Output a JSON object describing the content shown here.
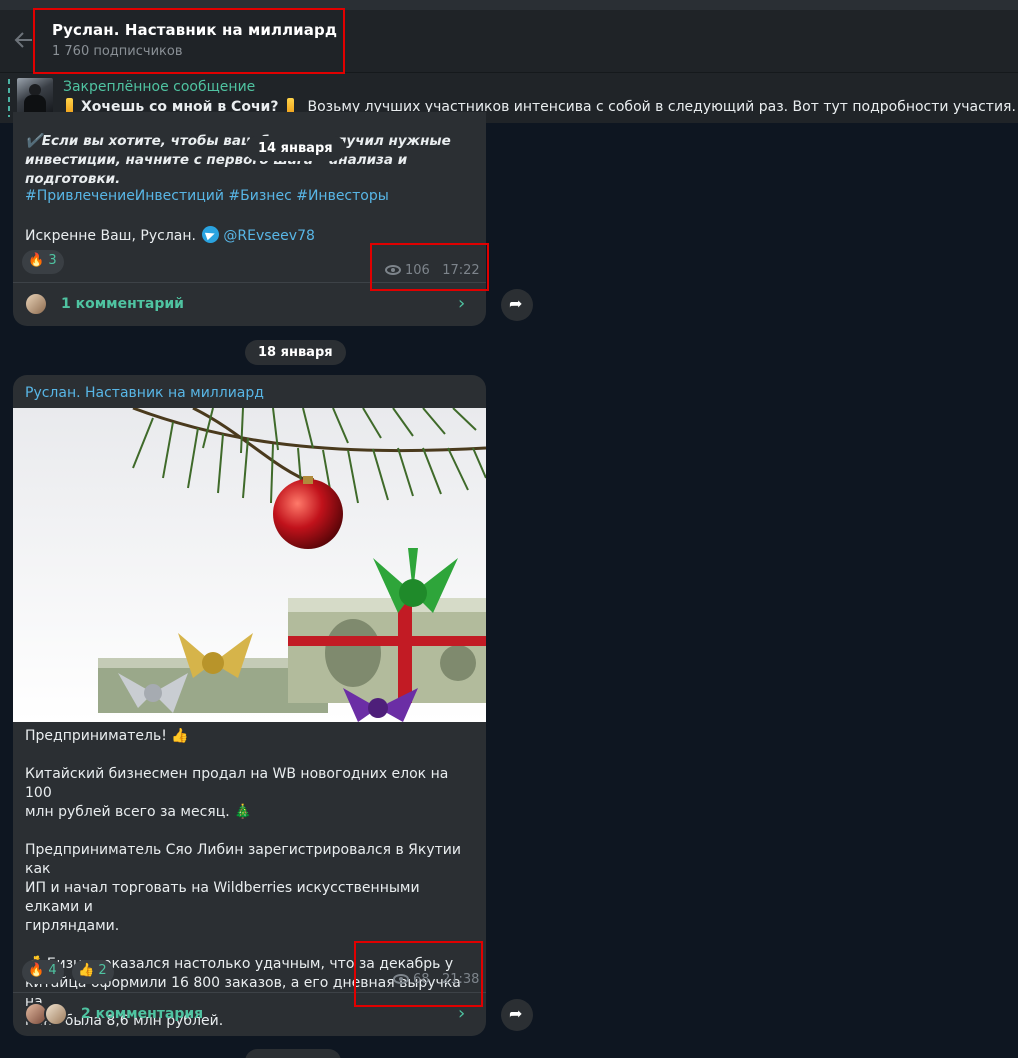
{
  "header": {
    "title": "Руслан. Наставник на миллиард",
    "subscribers": "1 760 подписчиков"
  },
  "pinned": {
    "title": "Закреплённое сообщение",
    "text_bold": "Хочешь со мной в Сочи?",
    "text_rest": "Возьму лучших участников интенсива с собой в следующий раз. Вот тут подробности участия."
  },
  "msg1": {
    "date_pill": "14 января",
    "text_line1": "✔️Если вы хотите, чтобы ваш бизнес получил нужные",
    "text_line2": "инвестиции, начните с первого шага – анализа и подготовки.",
    "hashtags": "#ПривлечениеИнвестиций #Бизнес #Инвесторы",
    "sign_text": "Искренне Ваш, Руслан.",
    "sign_user": "@REvseev78",
    "reaction": {
      "emoji": "🔥",
      "count": "3"
    },
    "views": "106",
    "time": "17:22",
    "comments": "1 комментарий"
  },
  "msg2": {
    "date_pill": "18 января",
    "sender": "Руслан. Наставник на миллиард",
    "body": "Предприниматель! 👍\n\nКитайский бизнесмен продал на WB новогодних елок на 100\nмлн рублей всего за месяц. 🎄\n\nПредприниматель Сяо Либин зарегистрировался в Якутии как\nИП и начал торговать на Wildberries искусственными елками и\nгирляндами.\n\n💰 Бизнес оказался настолько удачным, что за декабрь у\nкитайца оформили 16 800 заказов, а его дневная выручка на\nпике была 8,6 млн рублей.",
    "reactions": [
      {
        "emoji": "🔥",
        "count": "4"
      },
      {
        "emoji": "👍",
        "count": "2"
      }
    ],
    "views": "68",
    "time": "21:38",
    "comments": "2 комментария"
  },
  "colors": {
    "background": "#0e1621",
    "bubble": "#2b2f33",
    "accent_green": "#4fc3a1",
    "link_blue": "#58b6e6",
    "highlight_red": "#e00000"
  },
  "icons": [
    "back-arrow-icon",
    "pin-thumbnail",
    "eye-icon",
    "share-icon",
    "chevron-right-icon",
    "telegram-icon"
  ]
}
